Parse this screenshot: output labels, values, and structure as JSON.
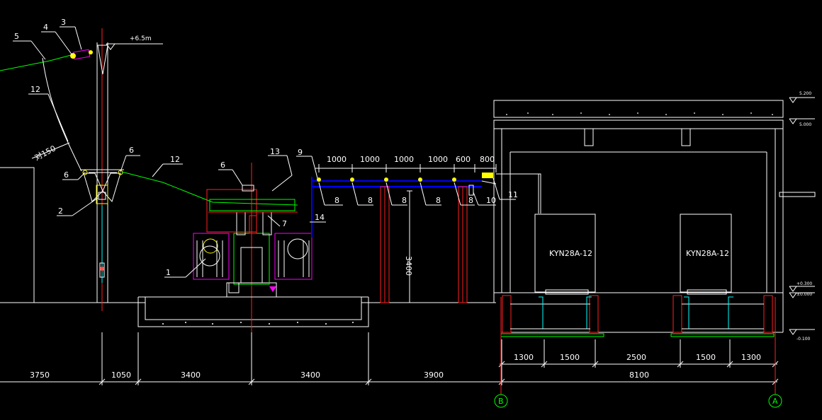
{
  "drawing": {
    "elevation_top": "+6.5m",
    "angle_label": "对150",
    "callouts": {
      "c1": "1",
      "c2": "2",
      "c3": "3",
      "c4": "4",
      "c5": "5",
      "c6a": "6",
      "c6b": "6",
      "c6c": "6",
      "c7": "7",
      "c8a": "8",
      "c8b": "8",
      "c8c": "8",
      "c8d": "8",
      "c8e": "8",
      "c9": "9",
      "c10": "10",
      "c11": "11",
      "c12a": "12",
      "c12b": "12",
      "c13": "13",
      "c14": "14"
    },
    "bus_spacing": [
      "1000",
      "1000",
      "1000",
      "1000",
      "600",
      "800"
    ],
    "support_height": "3400",
    "switchgear_left": "KYN28A-12",
    "switchgear_right": "KYN28A-12",
    "right_levels": [
      "5.200",
      "5.000",
      "+0.300",
      "±0.000",
      "-0.100"
    ],
    "room_dims": [
      "1300",
      "1500",
      "2500",
      "1500",
      "1300"
    ],
    "room_total": "8100",
    "bottom_dims": [
      "3750",
      "1050",
      "3400",
      "3400",
      "3900"
    ],
    "axis_b": "B",
    "axis_a": "A"
  }
}
